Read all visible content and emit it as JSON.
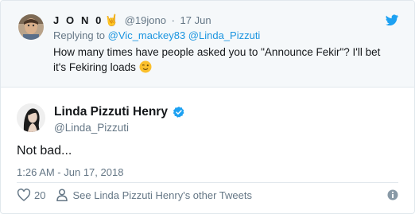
{
  "parent": {
    "name": "J O N 0",
    "handle": "@19jono",
    "separator": "·",
    "date": "17 Jun",
    "replying_prefix": "Replying to",
    "replying_to": [
      "@Vic_mackey83",
      "@Linda_Pizzuti"
    ],
    "text_line1": "How many times have people asked you to \"Announce Fekir\"? I'll bet",
    "text_line2": "it's Fekiring loads"
  },
  "main": {
    "name": "Linda Pizzuti Henry",
    "handle": "@Linda_Pizzuti",
    "text": "Not bad...",
    "timestamp": "1:26 AM - Jun 17, 2018"
  },
  "actions": {
    "like_count": "20",
    "see_more": "See Linda Pizzuti Henry's other Tweets"
  },
  "icons": {
    "brand": "twitter-bird-icon",
    "verified": "verified-badge-icon",
    "like": "heart-icon",
    "profile": "person-icon",
    "info": "info-icon",
    "emoji": "winking-face-icon",
    "horns": "sign-of-the-horns-icon"
  },
  "colors": {
    "link": "#1b95e0",
    "muted": "#657786",
    "parent_bg": "#f5f8fa",
    "border": "#e1e8ed"
  }
}
